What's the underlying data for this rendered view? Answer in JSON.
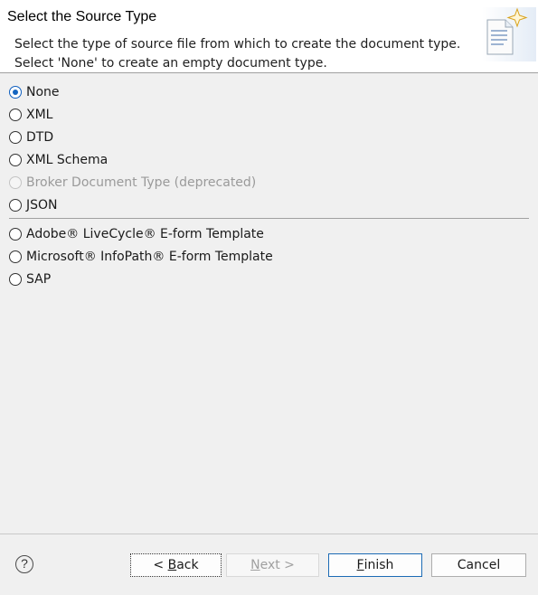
{
  "header": {
    "title": "Select the Source Type",
    "description_line1": "Select the type of source file from which to create the document type.",
    "description_line2": "Select 'None' to create an empty document type.",
    "image_icon": "wizard-document-sparkle-icon"
  },
  "options": [
    {
      "label": "None",
      "selected": true,
      "enabled": true
    },
    {
      "label": "XML",
      "selected": false,
      "enabled": true
    },
    {
      "label": "DTD",
      "selected": false,
      "enabled": true
    },
    {
      "label": "XML Schema",
      "selected": false,
      "enabled": true
    },
    {
      "label": "Broker Document Type (deprecated)",
      "selected": false,
      "enabled": false
    },
    {
      "label": "JSON",
      "selected": false,
      "enabled": true
    },
    {
      "label": "Adobe® LiveCycle® E-form Template",
      "selected": false,
      "enabled": true
    },
    {
      "label": "Microsoft® InfoPath® E-form Template",
      "selected": false,
      "enabled": true
    },
    {
      "label": "SAP",
      "selected": false,
      "enabled": true
    }
  ],
  "footer": {
    "help_glyph": "?",
    "back": {
      "prefix": "< ",
      "mnemonic": "B",
      "rest": "ack"
    },
    "next": {
      "mnemonic": "N",
      "rest": "ext >"
    },
    "finish": {
      "mnemonic": "F",
      "rest": "inish"
    },
    "cancel": "Cancel"
  },
  "colors": {
    "accent": "#1565c0",
    "disabled_text": "#9a9a9a"
  }
}
